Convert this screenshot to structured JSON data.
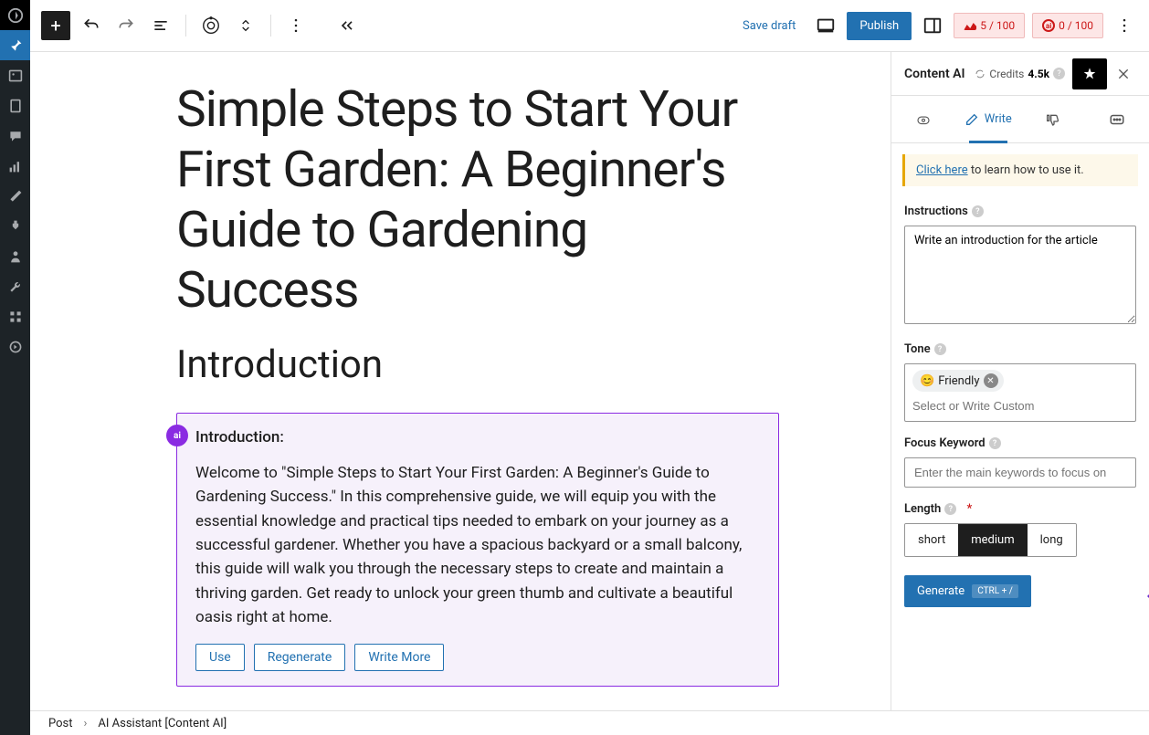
{
  "topbar": {
    "save_draft": "Save draft",
    "publish": "Publish",
    "badge1": "5 / 100",
    "badge2": "0 / 100"
  },
  "post": {
    "title": "Simple Steps to Start Your First Garden: A Beginner's Guide to Gardening Success",
    "section": "Introduction"
  },
  "ai_block": {
    "heading": "Introduction:",
    "text": "Welcome to \"Simple Steps to Start Your First Garden: A Beginner's Guide to Gardening Success.\" In this comprehensive guide, we will equip you with the essential knowledge and practical tips needed to embark on your journey as a successful gardener. Whether you have a spacious backyard or a small balcony, this guide will walk you through the necessary steps to create and maintain a thriving garden. Get ready to unlock your green thumb and cultivate a beautiful oasis right at home.",
    "use": "Use",
    "regenerate": "Regenerate",
    "write_more": "Write More"
  },
  "bottom": {
    "post": "Post",
    "crumb": "AI Assistant [Content AI]"
  },
  "panel": {
    "title": "Content AI",
    "credits_label": "Credits",
    "credits_value": "4.5k",
    "tabs": {
      "write": "Write"
    },
    "notice_link": "Click here",
    "notice_rest": " to learn how to use it.",
    "instructions_label": "Instructions",
    "instructions_value": "Write an introduction for the article",
    "tone_label": "Tone",
    "tone_chip": "Friendly",
    "tone_emoji": "😊",
    "tone_placeholder": "Select or Write Custom",
    "focus_label": "Focus Keyword",
    "focus_placeholder": "Enter the main keywords to focus on",
    "length_label": "Length",
    "length_short": "short",
    "length_medium": "medium",
    "length_long": "long",
    "generate": "Generate",
    "shortcut": "CTRL + /"
  }
}
